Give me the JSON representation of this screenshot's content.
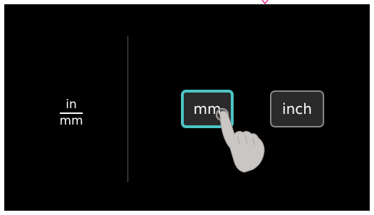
{
  "settings": {
    "unit_icon": {
      "name": "unit-fraction-icon",
      "numerator": "in",
      "denominator": "mm"
    },
    "options": [
      {
        "label": "mm",
        "selected": true
      },
      {
        "label": "inch",
        "selected": false
      }
    ],
    "colors": {
      "background": "#000000",
      "button_fill": "#2a2a2a",
      "selected_border": "#4cc4c4",
      "unselected_border": "#8a8a8a",
      "divider": "#5a5a5a",
      "hand": "#c9c6c4"
    },
    "pointer": {
      "icon": "tap-hand-icon",
      "target": "mm"
    }
  }
}
